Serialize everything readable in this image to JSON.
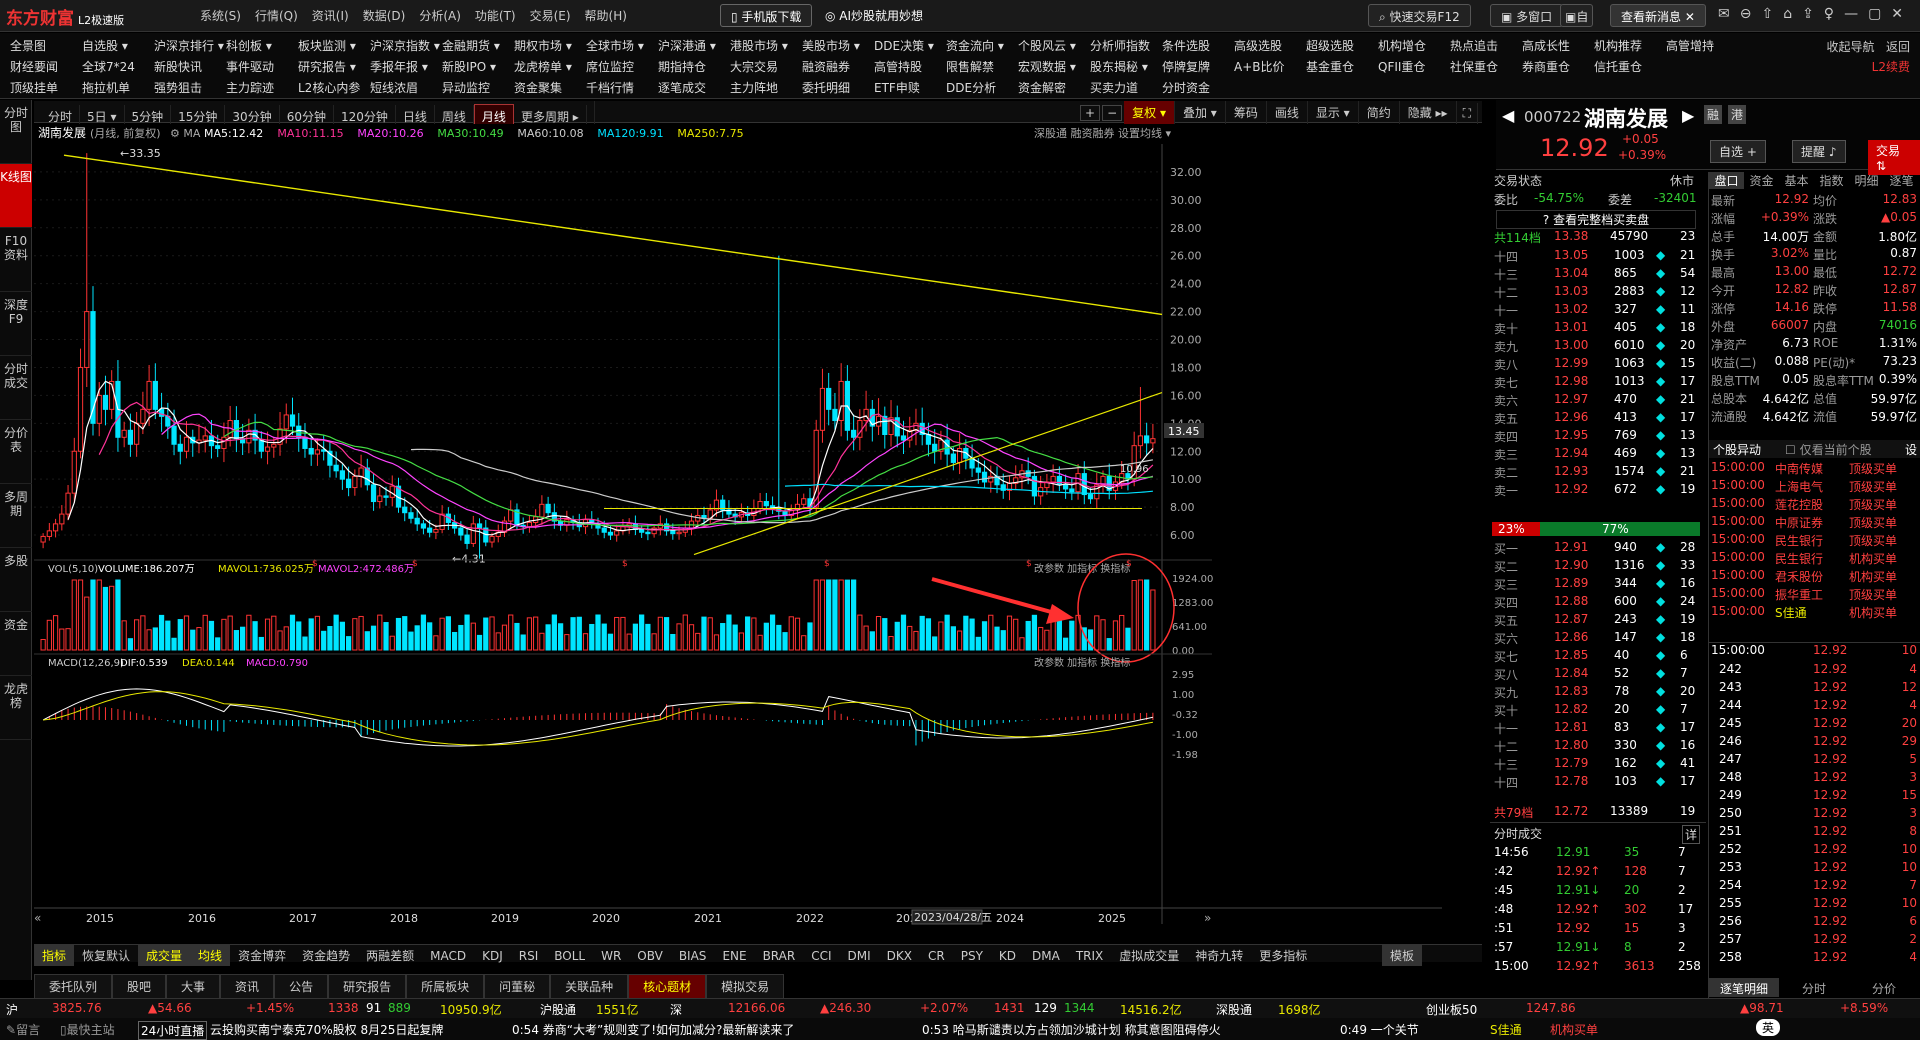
{
  "app": {
    "logo": "东方财富",
    "edition": "L2极速版",
    "menu": [
      "系统(S)",
      "行情(Q)",
      "资讯(I)",
      "数据(D)",
      "分析(A)",
      "功能(T)",
      "交易(E)",
      "帮助(H)"
    ],
    "mobile_btn": "手机版下载",
    "ai_btn": "AI炒股就用妙想",
    "quick_trade": "快速交易F12",
    "multi_window": "多窗口",
    "self_label": "自",
    "new_msg": "查看新消息"
  },
  "nav": {
    "row1": [
      "全景图",
      "自选股 ▾",
      "沪深京排行 ▾",
      "科创板 ▾",
      "板块监测 ▾",
      "沪深京指数 ▾",
      "金融期货 ▾",
      "期权市场 ▾",
      "全球市场 ▾",
      "沪深港通 ▾",
      "港股市场 ▾",
      "美股市场 ▾",
      "DDE决策 ▾",
      "资金流向 ▾",
      "个股风云 ▾",
      "分析师指数",
      "条件选股",
      "高级选股",
      "超级选股",
      "机构增仓",
      "热点追击",
      "高成长性",
      "机构推荐",
      "高管增持"
    ],
    "row2": [
      "财经要闻",
      "全球7*24",
      "新股快讯",
      "事件驱动",
      "研究报告 ▾",
      "季报年报 ▾",
      "新股IPO ▾",
      "龙虎榜单 ▾",
      "席位监控",
      "期指持仓",
      "大宗交易",
      "融资融券",
      "高管持股",
      "限售解禁",
      "宏观数据 ▾",
      "股东揭秘 ▾",
      "停牌复牌",
      "A+B比价",
      "基金重仓",
      "QFII重仓",
      "社保重仓",
      "券商重仓",
      "信托重仓"
    ],
    "row3": [
      "顶级挂单",
      "拖拉机单",
      "强势狙击",
      "主力踪迹",
      "L2核心内参",
      "短线浓眉",
      "异动监控",
      "资金聚集",
      "千档行情",
      "逐笔成交",
      "主力阵地",
      "委托明细",
      "ETF申赎",
      "DDE分析",
      "资金解密",
      "买卖力道",
      "分时资金"
    ],
    "right": [
      "收起导航",
      "返回",
      "L2续费"
    ]
  },
  "left_sidebar": [
    "分时图",
    "K线图",
    "F10资料",
    "深度F9",
    "分时成交",
    "分价表",
    "多周期",
    "多股",
    "资金",
    "龙虎榜"
  ],
  "period_tabs": [
    "分时",
    "5日 ▾",
    "5分钟",
    "15分钟",
    "30分钟",
    "60分钟",
    "120分钟",
    "日线",
    "周线",
    "月线",
    "更多周期 ▸"
  ],
  "period_active": "月线",
  "chart_tools": [
    "复权 ▾",
    "叠加 ▾",
    "筹码",
    "画线",
    "显示 ▾",
    "简约",
    "隐藏 ▸▸"
  ],
  "stock": {
    "name": "湖南发展",
    "code": "000722",
    "price": "12.92",
    "chg": "+0.05",
    "pct": "+0.39%",
    "header_note": "(月线, 前复权)",
    "self_select": "自选 +",
    "remind": "提醒",
    "trade": "交易",
    "mini_tags": [
      "融",
      "港"
    ]
  },
  "ma_legend": [
    {
      "label": "MA5:12.42",
      "color": "#ffffff"
    },
    {
      "label": "MA10:11.15",
      "color": "#ff3399"
    },
    {
      "label": "MA20:10.26",
      "color": "#ff44ff"
    },
    {
      "label": "MA30:10.49",
      "color": "#44dd44"
    },
    {
      "label": "MA60:10.08",
      "color": "#cccccc"
    },
    {
      "label": "MA120:9.91",
      "color": "#00e0ff"
    },
    {
      "label": "MA250:7.75",
      "color": "#e8e800"
    }
  ],
  "chart_top_right": [
    "深股通",
    "融资融券",
    "设置均线 ▾"
  ],
  "vol_legend": {
    "name": "VOL(5,10)",
    "vol": "VOLUME:186.207万",
    "mavol1": "MAVOL1:736.025万",
    "mavol2": "MAVOL2:472.486万"
  },
  "macd_legend": {
    "name": "MACD(12,26,9)",
    "dif": "DIF:0.539",
    "dea": "DEA:0.144",
    "macd": "MACD:0.790"
  },
  "sub_tools": [
    "改参数",
    "加指标",
    "换指标"
  ],
  "annotations": {
    "high": "33.35",
    "low": "4.31",
    "date_tip": "2023/04/28/五",
    "ma_tag": "10.96"
  },
  "chart_data": {
    "type": "candlestick",
    "period": "monthly",
    "ylim": [
      4.5,
      34
    ],
    "y_ticks": [
      "32.00",
      "30.00",
      "28.00",
      "26.00",
      "24.00",
      "22.00",
      "20.00",
      "18.00",
      "16.00",
      "14.00",
      "12.00",
      "10.00",
      "8.00",
      "6.00"
    ],
    "x_labels": [
      "2015",
      "2016",
      "2017",
      "2018",
      "2019",
      "2020",
      "2021",
      "2022",
      "2023",
      "2024",
      "2025"
    ],
    "price_tag": "13.45",
    "vol_ticks": [
      "1924.00",
      "1283.00",
      "641.00",
      "0.00"
    ],
    "macd_ticks": [
      "2.95",
      "1.00",
      "-0.32",
      "-1.00",
      "-1.98"
    ]
  },
  "bottom_tabs": [
    "指标",
    "恢复默认",
    "成交量",
    "均线",
    "资金博弈",
    "资金趋势",
    "两融差额",
    "MACD",
    "KDJ",
    "RSI",
    "BOLL",
    "WR",
    "OBV",
    "BIAS",
    "ENE",
    "BRAR",
    "CCI",
    "DMI",
    "DKX",
    "CR",
    "PSY",
    "KD",
    "DMA",
    "TRIX",
    "虚拟成交量",
    "神奇九转",
    "更多指标"
  ],
  "bottom_tab_right": "模板",
  "panel_tabs": [
    "委托队列",
    "股吧",
    "大事",
    "资讯",
    "公告",
    "研究报告",
    "所属板块",
    "问董秘",
    "关联品种",
    "核心题材",
    "模拟交易"
  ],
  "panel_active": "核心题材",
  "order_book": {
    "status": "交易状态",
    "status_val": "休市",
    "weibi_label": "委比",
    "weibi": "-54.75%",
    "weicha_label": "委差",
    "weicha": "-32401",
    "view_full": "查看完整档买卖盘",
    "sell_total": {
      "label": "共114档",
      "price": "13.38",
      "vol": "45790",
      "n": "23"
    },
    "asks": [
      [
        "十四",
        "13.05",
        "1003",
        "21"
      ],
      [
        "十三",
        "13.04",
        "865",
        "54"
      ],
      [
        "十二",
        "13.03",
        "2883",
        "12"
      ],
      [
        "十一",
        "13.02",
        "327",
        "11"
      ],
      [
        "卖十",
        "13.01",
        "405",
        "18"
      ],
      [
        "卖九",
        "13.00",
        "6010",
        "20"
      ],
      [
        "卖八",
        "12.99",
        "1063",
        "15"
      ],
      [
        "卖七",
        "12.98",
        "1013",
        "17"
      ],
      [
        "卖六",
        "12.97",
        "470",
        "21"
      ],
      [
        "卖五",
        "12.96",
        "413",
        "17"
      ],
      [
        "卖四",
        "12.95",
        "769",
        "13"
      ],
      [
        "卖三",
        "12.94",
        "469",
        "13"
      ],
      [
        "卖二",
        "12.93",
        "1574",
        "21"
      ],
      [
        "卖一",
        "12.92",
        "672",
        "19"
      ]
    ],
    "ratio": {
      "left": "23%",
      "right": "77%",
      "left_fraction": 0.23
    },
    "bids": [
      [
        "买一",
        "12.91",
        "940",
        "28"
      ],
      [
        "买二",
        "12.90",
        "1316",
        "33"
      ],
      [
        "买三",
        "12.89",
        "344",
        "16"
      ],
      [
        "买四",
        "12.88",
        "600",
        "24"
      ],
      [
        "买五",
        "12.87",
        "243",
        "19"
      ],
      [
        "买六",
        "12.86",
        "147",
        "18"
      ],
      [
        "买七",
        "12.85",
        "40",
        "6"
      ],
      [
        "买八",
        "12.84",
        "52",
        "7"
      ],
      [
        "买九",
        "12.83",
        "78",
        "20"
      ],
      [
        "买十",
        "12.82",
        "20",
        "7"
      ],
      [
        "十一",
        "12.81",
        "83",
        "17"
      ],
      [
        "十二",
        "12.80",
        "330",
        "16"
      ],
      [
        "十三",
        "12.79",
        "162",
        "41"
      ],
      [
        "十四",
        "12.78",
        "103",
        "17"
      ]
    ],
    "buy_total": {
      "label": "共79档",
      "price": "12.72",
      "vol": "13389",
      "n": "19"
    }
  },
  "right_tabs": [
    "盘口",
    "资金",
    "基本",
    "指数",
    "明细",
    "逐笔"
  ],
  "quote": [
    [
      "最新",
      "12.92",
      "均价",
      "12.83"
    ],
    [
      "涨幅",
      "+0.39%",
      "涨跌",
      "▲0.05"
    ],
    [
      "总手",
      "14.00万",
      "金额",
      "1.80亿"
    ],
    [
      "换手",
      "3.02%",
      "量比",
      "0.87"
    ],
    [
      "最高",
      "13.00",
      "最低",
      "12.72"
    ],
    [
      "今开",
      "12.82",
      "昨收",
      "12.87"
    ],
    [
      "涨停",
      "14.16",
      "跌停",
      "11.58"
    ],
    [
      "外盘",
      "66007",
      "内盘",
      "74016"
    ],
    [
      "净资产",
      "6.73",
      "ROE",
      "1.31%"
    ],
    [
      "收益(二)",
      "0.088",
      "PE(动)*",
      "73.23"
    ],
    [
      "股息TTM",
      "0.05",
      "股息率TTM",
      "0.39%"
    ],
    [
      "总股本",
      "4.642亿",
      "总值",
      "59.97亿"
    ],
    [
      "流通股",
      "4.642亿",
      "流值",
      "59.97亿"
    ]
  ],
  "anomaly": {
    "title": "个股异动",
    "checkbox": "仅看当前个股",
    "settings": "设",
    "rows": [
      [
        "15:00:00",
        "中南传媒",
        "顶级买单"
      ],
      [
        "15:00:00",
        "上海电气",
        "顶级买单"
      ],
      [
        "15:00:00",
        "莲花控股",
        "顶级买单"
      ],
      [
        "15:00:00",
        "中原证券",
        "顶级买单"
      ],
      [
        "15:00:00",
        "民生银行",
        "顶级买单"
      ],
      [
        "15:00:00",
        "民生银行",
        "机构买单"
      ],
      [
        "15:00:00",
        "君禾股份",
        "机构买单"
      ],
      [
        "15:00:00",
        "振华重工",
        "顶级买单"
      ],
      [
        "15:00:00",
        "S佳通",
        "机构买单"
      ]
    ]
  },
  "fen_trade": {
    "title": "分时成交",
    "detail_btn": "详",
    "rows": [
      [
        "14:56",
        "12.91",
        "35",
        "7",
        "g"
      ],
      [
        ":42",
        "12.92↑",
        "128",
        "7",
        "r"
      ],
      [
        ":45",
        "12.91↓",
        "20",
        "2",
        "g"
      ],
      [
        ":48",
        "12.92↑",
        "302",
        "17",
        "r"
      ],
      [
        ":51",
        "12.92",
        "15",
        "3",
        "r"
      ],
      [
        ":57",
        "12.91↓",
        "8",
        "2",
        "g"
      ],
      [
        "15:00",
        "12.92↑",
        "3613",
        "258",
        "r"
      ]
    ]
  },
  "zhubi": {
    "head": "15:00:00",
    "head_price": "12.92",
    "head_vol": "10",
    "rows": [
      [
        "242",
        "12.92",
        "4"
      ],
      [
        "243",
        "12.92",
        "12"
      ],
      [
        "244",
        "12.92",
        "4"
      ],
      [
        "245",
        "12.92",
        "20"
      ],
      [
        "246",
        "12.92",
        "29"
      ],
      [
        "247",
        "12.92",
        "5"
      ],
      [
        "248",
        "12.92",
        "3"
      ],
      [
        "249",
        "12.92",
        "15"
      ],
      [
        "250",
        "12.92",
        "3"
      ],
      [
        "251",
        "12.92",
        "8"
      ],
      [
        "252",
        "12.92",
        "10"
      ],
      [
        "253",
        "12.92",
        "10"
      ],
      [
        "254",
        "12.92",
        "7"
      ],
      [
        "255",
        "12.92",
        "10"
      ],
      [
        "256",
        "12.92",
        "6"
      ],
      [
        "257",
        "12.92",
        "2"
      ],
      [
        "258",
        "12.92",
        "4"
      ]
    ],
    "tabs": [
      "逐笔明细",
      "分时",
      "分价"
    ]
  },
  "statusbar": {
    "sh_label": "沪",
    "sh_idx": "3825.76",
    "sh_chg": "▲54.66",
    "sh_pct": "+1.45%",
    "sh_up": "1338",
    "sh_flat": "91",
    "sh_down": "889",
    "sh_amt": "10950.9亿",
    "hgt_label": "沪股通",
    "hgt_val": "1551亿",
    "sz_label": "深",
    "sz_idx": "12166.06",
    "sz_chg": "▲246.30",
    "sz_pct": "+2.07%",
    "sz_up": "1431",
    "sz_flat": "129",
    "sz_down": "1344",
    "sz_amt": "14516.2亿",
    "sgt_label": "深股通",
    "sgt_val": "1698亿",
    "cy_label": "创业板50",
    "cy_idx": "1247.86",
    "cy_chg": "▲98.71",
    "cy_pct": "+8.59%"
  },
  "news": {
    "left": [
      "留言",
      "最快主站",
      "24小时直播"
    ],
    "items": [
      "云投购买南宁泰克70%股权 8月25日起复牌",
      "0:54 券商“大考”规则变了!如何加减分?最新解读来了",
      "0:53 哈马斯谴责以方占领加沙城计划 称其意图阻碍停火",
      "0:49 一个关节"
    ],
    "right": [
      "S佳通",
      "机构买单"
    ],
    "ime": "英"
  }
}
